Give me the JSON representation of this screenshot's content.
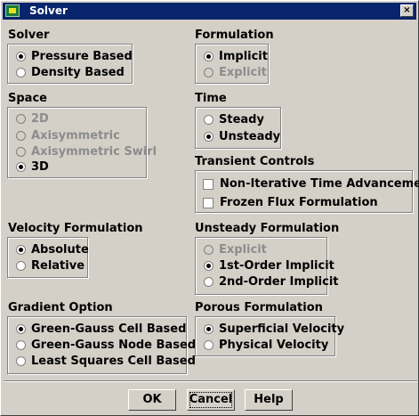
{
  "window": {
    "title": "Solver",
    "close_symbol": "×"
  },
  "sections": {
    "solver": {
      "title": "Solver",
      "options": [
        {
          "label": "Pressure Based",
          "selected": true,
          "enabled": true
        },
        {
          "label": "Density Based",
          "selected": false,
          "enabled": true
        }
      ]
    },
    "formulation": {
      "title": "Formulation",
      "options": [
        {
          "label": "Implicit",
          "selected": true,
          "enabled": true
        },
        {
          "label": "Explicit",
          "selected": false,
          "enabled": false
        }
      ]
    },
    "space": {
      "title": "Space",
      "options": [
        {
          "label": "2D",
          "selected": false,
          "enabled": false
        },
        {
          "label": "Axisymmetric",
          "selected": false,
          "enabled": false
        },
        {
          "label": "Axisymmetric Swirl",
          "selected": false,
          "enabled": false
        },
        {
          "label": "3D",
          "selected": true,
          "enabled": true
        }
      ]
    },
    "time": {
      "title": "Time",
      "options": [
        {
          "label": "Steady",
          "selected": false,
          "enabled": true
        },
        {
          "label": "Unsteady",
          "selected": true,
          "enabled": true
        }
      ]
    },
    "transient_controls": {
      "title": "Transient Controls",
      "checkboxes": [
        {
          "label": "Non-Iterative Time Advancement",
          "checked": false
        },
        {
          "label": "Frozen Flux Formulation",
          "checked": false
        }
      ]
    },
    "velocity_formulation": {
      "title": "Velocity Formulation",
      "options": [
        {
          "label": "Absolute",
          "selected": true,
          "enabled": true
        },
        {
          "label": "Relative",
          "selected": false,
          "enabled": true
        }
      ]
    },
    "unsteady_formulation": {
      "title": "Unsteady Formulation",
      "options": [
        {
          "label": "Explicit",
          "selected": false,
          "enabled": false
        },
        {
          "label": "1st-Order Implicit",
          "selected": true,
          "enabled": true
        },
        {
          "label": "2nd-Order Implicit",
          "selected": false,
          "enabled": true
        }
      ]
    },
    "gradient_option": {
      "title": "Gradient Option",
      "options": [
        {
          "label": "Green-Gauss Cell Based",
          "selected": true,
          "enabled": true
        },
        {
          "label": "Green-Gauss Node Based",
          "selected": false,
          "enabled": true
        },
        {
          "label": "Least Squares Cell Based",
          "selected": false,
          "enabled": true
        }
      ]
    },
    "porous_formulation": {
      "title": "Porous Formulation",
      "options": [
        {
          "label": "Superficial Velocity",
          "selected": true,
          "enabled": true
        },
        {
          "label": "Physical Velocity",
          "selected": false,
          "enabled": true
        }
      ]
    }
  },
  "buttons": {
    "ok": "OK",
    "cancel": "Cancel",
    "help": "Help"
  },
  "colors": {
    "titlebar": "#08246b",
    "dialog_bg": "#d4d0c8",
    "disabled_text": "#8c8c8c"
  }
}
